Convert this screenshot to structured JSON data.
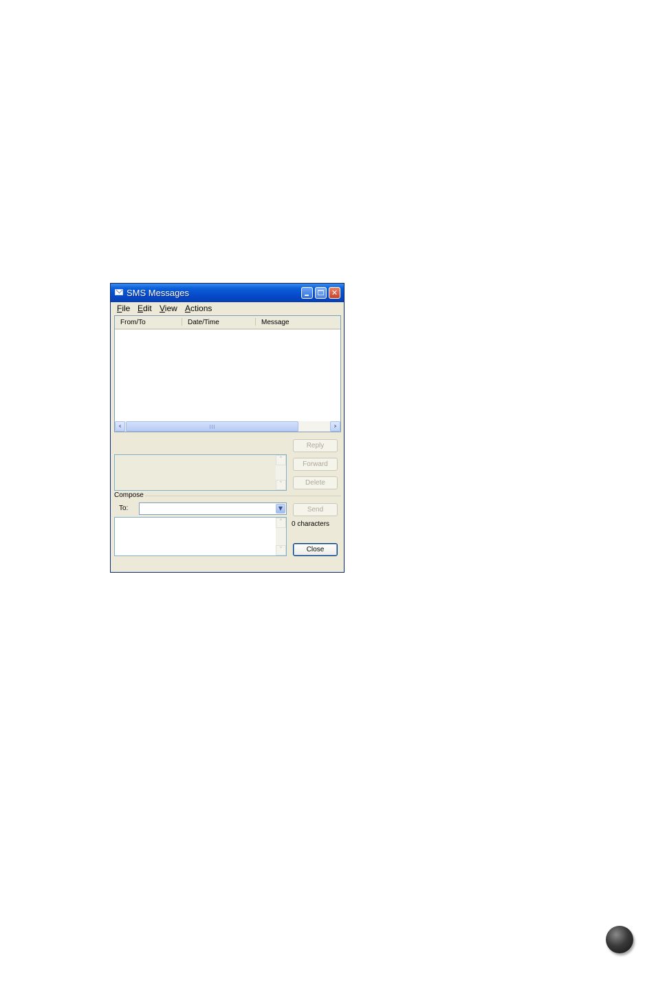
{
  "window": {
    "title": "SMS Messages",
    "close_glyph": "✕"
  },
  "menu": [
    "File",
    "Edit",
    "View",
    "Actions"
  ],
  "list": {
    "columns": [
      "From/To",
      "Date/Time",
      "Message"
    ]
  },
  "buttons": {
    "reply": "Reply",
    "forward": "Forward",
    "delete": "Delete",
    "send": "Send",
    "close": "Close"
  },
  "compose": {
    "group_label": "Compose",
    "to_label": "To:",
    "to_value": "",
    "character_count": "0 characters"
  },
  "icons": {
    "scroll_left": "‹",
    "scroll_right": "›",
    "scroll_up": "˄",
    "scroll_down": "˅",
    "dropdown": "▼"
  }
}
